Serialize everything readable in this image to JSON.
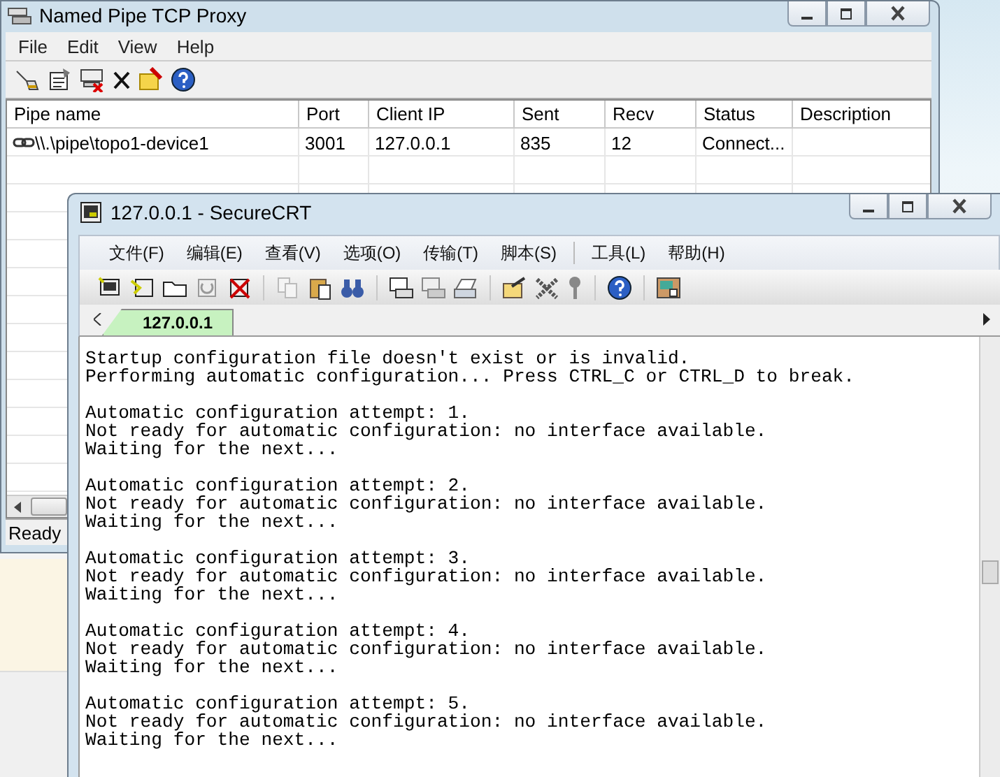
{
  "proxy_window": {
    "title": "Named Pipe TCP Proxy",
    "menu": [
      "File",
      "Edit",
      "View",
      "Help"
    ],
    "table": {
      "columns": [
        "Pipe name",
        "Port",
        "Client IP",
        "Sent",
        "Recv",
        "Status",
        "Description"
      ],
      "rows": [
        {
          "cells": [
            "\\\\.\\pipe\\topo1-device1",
            "3001",
            "127.0.0.1",
            "835",
            "12",
            "Connect..."
          ]
        }
      ]
    },
    "status_bar": "Ready"
  },
  "crt_window": {
    "title": "127.0.0.1 - SecureCRT",
    "menu": [
      "文件(F)",
      "编辑(E)",
      "查看(V)",
      "选项(O)",
      "传输(T)",
      "脚本(S)",
      "工具(L)",
      "帮助(H)"
    ],
    "tabs": [
      {
        "label": "127.0.0.1",
        "selected": true
      }
    ],
    "terminal": [
      [
        "Startup configuration file doesn't exist or is invalid.",
        "Performing automatic configuration... Press CTRL_C or CTRL_D to break."
      ],
      [
        "Automatic configuration attempt: 1.",
        "Not ready for automatic configuration: no interface available.",
        "Waiting for the next..."
      ],
      [
        "Automatic configuration attempt: 2.",
        "Not ready for automatic configuration: no interface available.",
        "Waiting for the next..."
      ],
      [
        "Automatic configuration attempt: 3.",
        "Not ready for automatic configuration: no interface available.",
        "Waiting for the next..."
      ],
      [
        "Automatic configuration attempt: 4.",
        "Not ready for automatic configuration: no interface available.",
        "Waiting for the next..."
      ],
      [
        "Automatic configuration attempt: 5.",
        "Not ready for automatic configuration: no interface available.",
        "Waiting for the next..."
      ]
    ]
  }
}
